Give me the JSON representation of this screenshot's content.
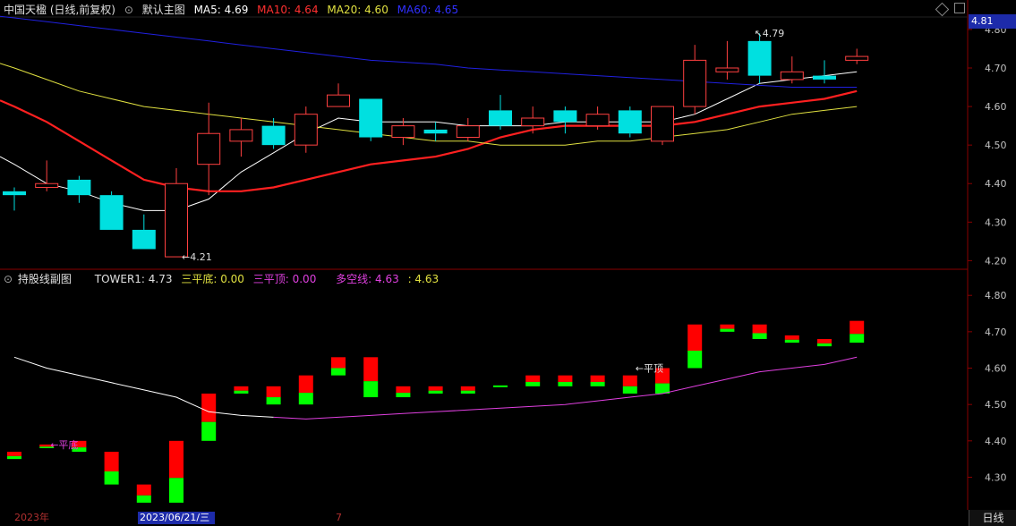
{
  "main_header": {
    "title": "中国天楹 (日线,前复权)",
    "indicator_name": "默认主图",
    "ma5": "MA5: 4.69",
    "ma10": "MA10: 4.64",
    "ma20": "MA20: 4.60",
    "ma60": "MA60: 4.65"
  },
  "sub_header": {
    "indicator_name": "持股线副图",
    "tower1": "TOWER1: 4.73",
    "sanpingdi": "三平底: 0.00",
    "sanpingding": "三平顶: 0.00",
    "duokongxian": "多空线: 4.63",
    "last": ": 4.63"
  },
  "current_price_tag": "4.81",
  "bottom": {
    "year": "2023年",
    "date_chip": "2023/06/21/三",
    "month_mark": "7",
    "period_tab": "日线"
  },
  "annotations": {
    "high": "4.79",
    "low": "4.21",
    "pingding": "平顶",
    "pingdi": "平底"
  },
  "colors": {
    "up": "#ff4040",
    "down": "#00e0e0",
    "ma5": "#ffffff",
    "ma10": "#ff2020",
    "ma20": "#e0e040",
    "ma60": "#2020e0",
    "tower_up": "#ff0000",
    "tower_down": "#00ff00",
    "duokong": "#e040e0"
  },
  "chart_data": [
    {
      "type": "candlestick",
      "title": "中国天楹 (日线,前复权)",
      "y_ticks": [
        "4.80",
        "4.70",
        "4.60",
        "4.50",
        "4.40",
        "4.30",
        "4.20"
      ],
      "ylim": [
        4.18,
        4.83
      ],
      "candles": [
        {
          "o": 4.38,
          "c": 4.37,
          "h": 4.39,
          "l": 4.33
        },
        {
          "o": 4.39,
          "c": 4.4,
          "h": 4.46,
          "l": 4.38
        },
        {
          "o": 4.41,
          "c": 4.37,
          "h": 4.42,
          "l": 4.35
        },
        {
          "o": 4.37,
          "c": 4.28,
          "h": 4.38,
          "l": 4.28
        },
        {
          "o": 4.28,
          "c": 4.23,
          "h": 4.32,
          "l": 4.23
        },
        {
          "o": 4.21,
          "c": 4.4,
          "h": 4.44,
          "l": 4.21
        },
        {
          "o": 4.45,
          "c": 4.53,
          "h": 4.61,
          "l": 4.37
        },
        {
          "o": 4.51,
          "c": 4.54,
          "h": 4.57,
          "l": 4.47
        },
        {
          "o": 4.55,
          "c": 4.5,
          "h": 4.57,
          "l": 4.49
        },
        {
          "o": 4.5,
          "c": 4.58,
          "h": 4.6,
          "l": 4.48
        },
        {
          "o": 4.6,
          "c": 4.63,
          "h": 4.66,
          "l": 4.6
        },
        {
          "o": 4.62,
          "c": 4.52,
          "h": 4.62,
          "l": 4.51
        },
        {
          "o": 4.52,
          "c": 4.55,
          "h": 4.57,
          "l": 4.5
        },
        {
          "o": 4.54,
          "c": 4.53,
          "h": 4.56,
          "l": 4.51
        },
        {
          "o": 4.52,
          "c": 4.55,
          "h": 4.57,
          "l": 4.51
        },
        {
          "o": 4.59,
          "c": 4.55,
          "h": 4.63,
          "l": 4.54
        },
        {
          "o": 4.55,
          "c": 4.57,
          "h": 4.6,
          "l": 4.53
        },
        {
          "o": 4.59,
          "c": 4.56,
          "h": 4.6,
          "l": 4.53
        },
        {
          "o": 4.55,
          "c": 4.58,
          "h": 4.6,
          "l": 4.54
        },
        {
          "o": 4.59,
          "c": 4.53,
          "h": 4.6,
          "l": 4.52
        },
        {
          "o": 4.51,
          "c": 4.6,
          "h": 4.6,
          "l": 4.5
        },
        {
          "o": 4.6,
          "c": 4.72,
          "h": 4.76,
          "l": 4.58
        },
        {
          "o": 4.69,
          "c": 4.7,
          "h": 4.77,
          "l": 4.67
        },
        {
          "o": 4.77,
          "c": 4.68,
          "h": 4.79,
          "l": 4.66
        },
        {
          "o": 4.67,
          "c": 4.69,
          "h": 4.73,
          "l": 4.66
        },
        {
          "o": 4.68,
          "c": 4.67,
          "h": 4.72,
          "l": 4.66
        },
        {
          "o": 4.72,
          "c": 4.73,
          "h": 4.75,
          "l": 4.71
        }
      ],
      "series": [
        {
          "name": "MA5",
          "values": [
            4.45,
            4.4,
            4.38,
            4.35,
            4.33,
            4.33,
            4.36,
            4.43,
            4.48,
            4.53,
            4.57,
            4.56,
            4.56,
            4.56,
            4.55,
            4.55,
            4.55,
            4.56,
            4.56,
            4.56,
            4.56,
            4.58,
            4.62,
            4.66,
            4.67,
            4.68,
            4.69
          ]
        },
        {
          "name": "MA10",
          "values": [
            4.6,
            4.56,
            4.51,
            4.46,
            4.41,
            4.39,
            4.38,
            4.38,
            4.39,
            4.41,
            4.43,
            4.45,
            4.46,
            4.47,
            4.49,
            4.52,
            4.54,
            4.55,
            4.55,
            4.55,
            4.55,
            4.56,
            4.58,
            4.6,
            4.61,
            4.62,
            4.64
          ]
        },
        {
          "name": "MA20",
          "values": [
            4.7,
            4.67,
            4.64,
            4.62,
            4.6,
            4.59,
            4.58,
            4.57,
            4.56,
            4.55,
            4.54,
            4.53,
            4.52,
            4.51,
            4.51,
            4.5,
            4.5,
            4.5,
            4.51,
            4.51,
            4.52,
            4.53,
            4.54,
            4.56,
            4.58,
            4.59,
            4.6
          ]
        },
        {
          "name": "MA60",
          "values": [
            4.83,
            4.82,
            4.81,
            4.8,
            4.79,
            4.78,
            4.77,
            4.76,
            4.75,
            4.74,
            4.73,
            4.72,
            4.715,
            4.71,
            4.7,
            4.695,
            4.69,
            4.685,
            4.68,
            4.675,
            4.67,
            4.665,
            4.66,
            4.655,
            4.65,
            4.65,
            4.65
          ]
        }
      ]
    },
    {
      "type": "bar",
      "title": "持股线副图",
      "y_ticks": [
        "4.80",
        "4.70",
        "4.60",
        "4.50",
        "4.40",
        "4.30"
      ],
      "ylim": [
        4.22,
        4.83
      ],
      "towers": [
        {
          "a": 4.37,
          "b": 4.35
        },
        {
          "a": 4.38,
          "b": 4.39
        },
        {
          "a": 4.37,
          "b": 4.4
        },
        {
          "a": 4.37,
          "b": 4.28
        },
        {
          "a": 4.28,
          "b": 4.23
        },
        {
          "a": 4.23,
          "b": 4.4
        },
        {
          "a": 4.4,
          "b": 4.53
        },
        {
          "a": 4.53,
          "b": 4.55
        },
        {
          "a": 4.5,
          "b": 4.55
        },
        {
          "a": 4.5,
          "b": 4.58
        },
        {
          "a": 4.58,
          "b": 4.63
        },
        {
          "a": 4.63,
          "b": 4.52
        },
        {
          "a": 4.52,
          "b": 4.55
        },
        {
          "a": 4.53,
          "b": 4.55
        },
        {
          "a": 4.53,
          "b": 4.55
        },
        {
          "a": 4.55,
          "b": 4.55
        },
        {
          "a": 4.55,
          "b": 4.58
        },
        {
          "a": 4.55,
          "b": 4.58
        },
        {
          "a": 4.55,
          "b": 4.58
        },
        {
          "a": 4.53,
          "b": 4.58
        },
        {
          "a": 4.53,
          "b": 4.6
        },
        {
          "a": 4.6,
          "b": 4.72
        },
        {
          "a": 4.7,
          "b": 4.72
        },
        {
          "a": 4.68,
          "b": 4.72
        },
        {
          "a": 4.67,
          "b": 4.69
        },
        {
          "a": 4.66,
          "b": 4.68
        },
        {
          "a": 4.67,
          "b": 4.73
        }
      ],
      "series": [
        {
          "name": "多空线",
          "values": [
            4.63,
            4.6,
            4.58,
            4.56,
            4.54,
            4.52,
            4.48,
            4.47,
            4.465,
            4.46,
            4.465,
            4.47,
            4.475,
            4.48,
            4.485,
            4.49,
            4.495,
            4.5,
            4.51,
            4.52,
            4.53,
            4.55,
            4.57,
            4.59,
            4.6,
            4.61,
            4.63
          ]
        }
      ]
    }
  ]
}
